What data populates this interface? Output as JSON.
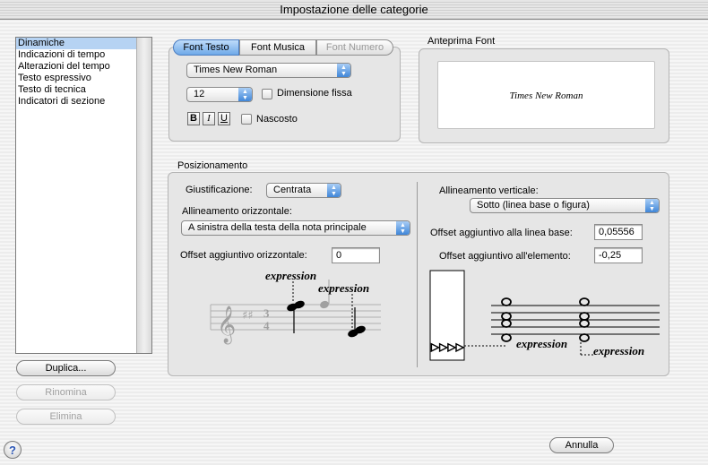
{
  "window": {
    "title": "Impostazione delle categorie"
  },
  "categories": {
    "items": [
      "Dinamiche",
      "Indicazioni di tempo",
      "Alterazioni del tempo",
      "Testo espressivo",
      "Testo di tecnica",
      "Indicatori di sezione"
    ],
    "selected_index": 0
  },
  "left_buttons": {
    "duplicate": "Duplica...",
    "rename": "Rinomina",
    "delete": "Elimina"
  },
  "font": {
    "tabs": [
      "Font Testo",
      "Font Musica",
      "Font Numero"
    ],
    "active_tab": "Font Testo",
    "family": "Times New Roman",
    "size": "12",
    "fixed_size_label": "Dimensione fissa",
    "bold": "B",
    "italic": "I",
    "underline": "U",
    "hidden_label": "Nascosto"
  },
  "preview": {
    "label": "Anteprima Font",
    "text": "Times New Roman"
  },
  "positioning": {
    "label": "Posizionamento",
    "justification_label": "Giustificazione:",
    "justification_value": "Centrata",
    "horizontal_label": "Allineamento orizzontale:",
    "horizontal_value": "A sinistra della testa della nota principale",
    "h_offset_label": "Offset aggiuntivo orizzontale:",
    "h_offset_value": "0",
    "vertical_label": "Allineamento verticale:",
    "vertical_value": "Sotto (linea base o figura)",
    "baseline_offset_label": "Offset aggiuntivo alla linea base:",
    "baseline_offset_value": "0,05556",
    "element_offset_label": "Offset aggiuntivo all'elemento:",
    "element_offset_value": "-0,25",
    "example_text": "expression"
  },
  "footer": {
    "cancel": "Annulla",
    "help": "?"
  }
}
